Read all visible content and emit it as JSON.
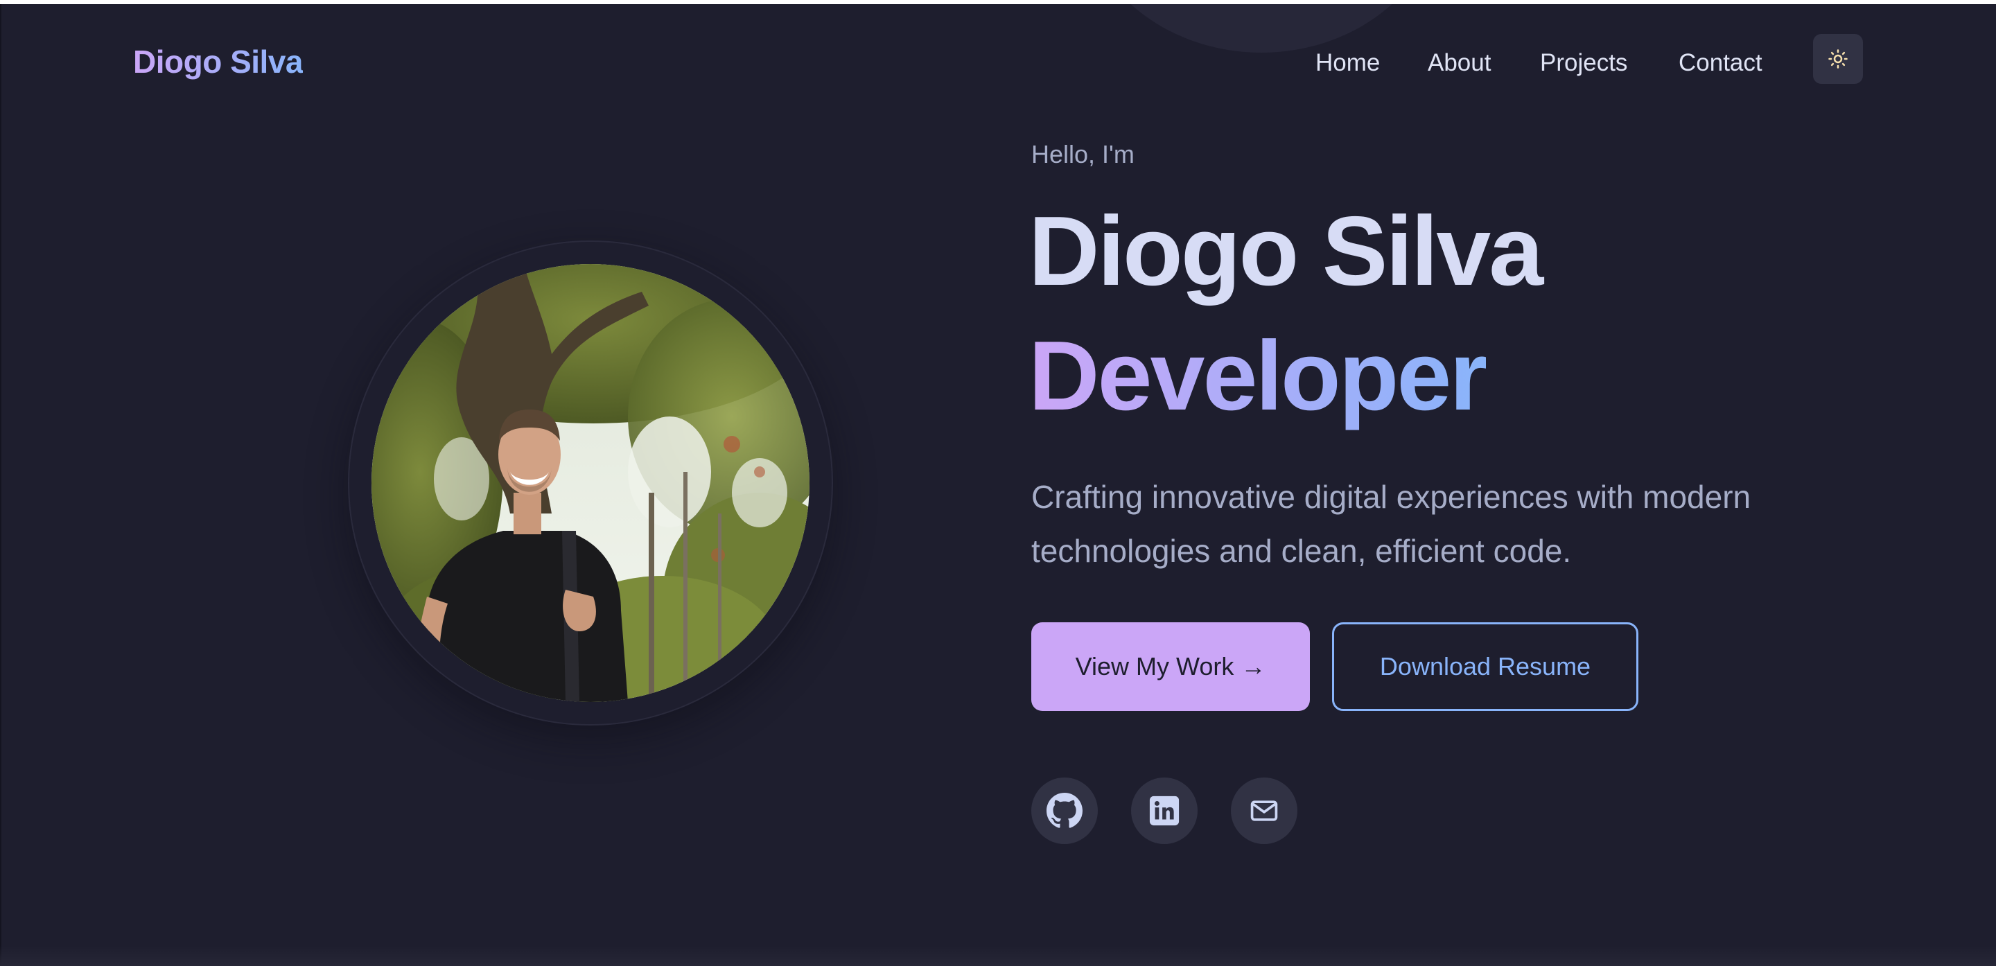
{
  "header": {
    "brand": "Diogo Silva",
    "nav": [
      {
        "label": "Home"
      },
      {
        "label": "About"
      },
      {
        "label": "Projects"
      },
      {
        "label": "Contact"
      }
    ],
    "theme_toggle_icon": "sun-icon"
  },
  "hero": {
    "greeting": "Hello, I'm",
    "name": "Diogo Silva",
    "role": "Developer",
    "tagline": "Crafting innovative digital experiences with modern technologies and clean, efficient code.",
    "primary_button": "View My Work →",
    "secondary_button": "Download Resume",
    "portrait_icon": "profile-photo"
  },
  "social": [
    {
      "icon": "github-icon"
    },
    {
      "icon": "linkedin-icon"
    },
    {
      "icon": "mail-icon"
    }
  ],
  "colors": {
    "background": "#1e1e2e",
    "surface": "#313244",
    "accent_purple": "#cba6f7",
    "accent_blue": "#89b4fa",
    "text": "#d7dcf5",
    "muted_text": "#a6adc8"
  }
}
